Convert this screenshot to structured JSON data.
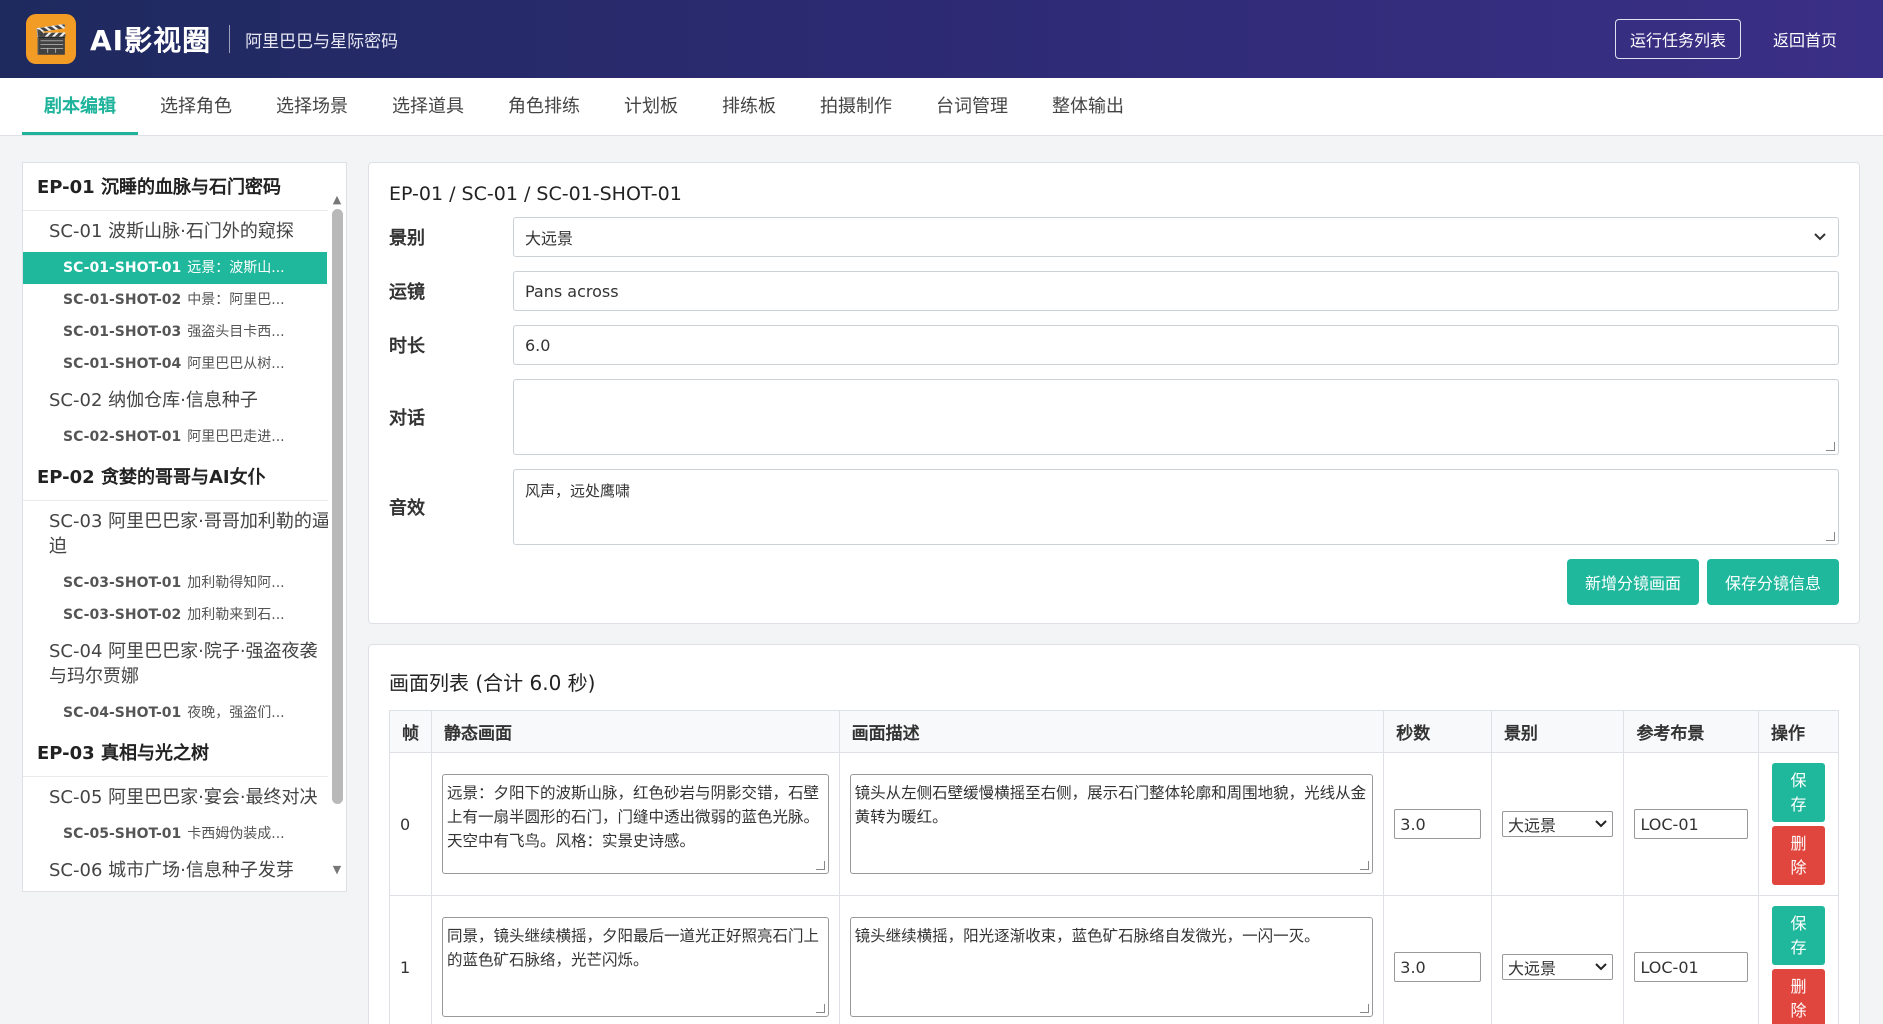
{
  "header": {
    "logo_glyph": "🎬",
    "app_name": "AI影视圈",
    "project_name": "阿里巴巴与星际密码",
    "run_tasks_label": "运行任务列表",
    "back_home_label": "返回首页"
  },
  "tabs": [
    {
      "label": "剧本编辑",
      "active": true
    },
    {
      "label": "选择角色"
    },
    {
      "label": "选择场景"
    },
    {
      "label": "选择道具"
    },
    {
      "label": "角色排练"
    },
    {
      "label": "计划板"
    },
    {
      "label": "排练板"
    },
    {
      "label": "拍摄制作"
    },
    {
      "label": "台词管理"
    },
    {
      "label": "整体输出"
    }
  ],
  "sidebar": {
    "ep01": "EP-01 沉睡的血脉与石门密码",
    "sc01": "SC-01 波斯山脉·石门外的窥探",
    "sc01_shots": [
      {
        "id": "SC-01-SHOT-01",
        "desc": "远景：波斯山..."
      },
      {
        "id": "SC-01-SHOT-02",
        "desc": "中景：阿里巴..."
      },
      {
        "id": "SC-01-SHOT-03",
        "desc": "强盗头目卡西..."
      },
      {
        "id": "SC-01-SHOT-04",
        "desc": "阿里巴巴从树..."
      }
    ],
    "sc02": "SC-02 纳伽仓库·信息种子",
    "sc02_shots": [
      {
        "id": "SC-02-SHOT-01",
        "desc": "阿里巴巴走进..."
      }
    ],
    "ep02": "EP-02 贪婪的哥哥与AI女仆",
    "sc03": "SC-03 阿里巴巴家·哥哥加利勒的逼迫",
    "sc03_shots": [
      {
        "id": "SC-03-SHOT-01",
        "desc": "加利勒得知阿..."
      },
      {
        "id": "SC-03-SHOT-02",
        "desc": "加利勒来到石..."
      }
    ],
    "sc04": "SC-04 阿里巴巴家·院子·强盗夜袭与玛尔贾娜",
    "sc04_shots": [
      {
        "id": "SC-04-SHOT-01",
        "desc": "夜晚，强盗们..."
      }
    ],
    "ep03": "EP-03 真相与光之树",
    "sc05": "SC-05 阿里巴巴家·宴会·最终对决",
    "sc05_shots": [
      {
        "id": "SC-05-SHOT-01",
        "desc": "卡西姆伪装成..."
      }
    ],
    "sc06": "SC-06 城市广场·信息种子发芽"
  },
  "shot_form": {
    "breadcrumb": "EP-01 / SC-01 / SC-01-SHOT-01",
    "shot_size_label": "景别",
    "shot_size_value": "大远景",
    "camera_move_label": "运镜",
    "camera_move_value": "Pans across",
    "duration_label": "时长",
    "duration_value": "6.0",
    "dialogue_label": "对话",
    "dialogue_value": "",
    "sfx_label": "音效",
    "sfx_value": "风声，远处鹰啸",
    "add_frame_label": "新增分镜画面",
    "save_shot_label": "保存分镜信息"
  },
  "frames": {
    "title": "画面列表 (合计 6.0 秒)",
    "headers": [
      "帧",
      "静态画面",
      "画面描述",
      "秒数",
      "景别",
      "参考布景",
      "操作"
    ],
    "save_label": "保存",
    "delete_label": "删除",
    "rows": [
      {
        "index": "0",
        "still": "远景：夕阳下的波斯山脉，红色砂岩与阴影交错，石壁上有一扇半圆形的石门，门缝中透出微弱的蓝色光脉。天空中有飞鸟。风格：实景史诗感。",
        "desc": "镜头从左侧石壁缓慢横摇至右侧，展示石门整体轮廓和周围地貌，光线从金黄转为暖红。",
        "seconds": "3.0",
        "size": "大远景",
        "location": "LOC-01"
      },
      {
        "index": "1",
        "still": "同景，镜头继续横摇，夕阳最后一道光正好照亮石门上的蓝色矿石脉络，光芒闪烁。",
        "desc": "镜头继续横摇，阳光逐渐收束，蓝色矿石脉络自发微光，一闪一灭。",
        "seconds": "3.0",
        "size": "大远景",
        "location": "LOC-01"
      }
    ]
  }
}
